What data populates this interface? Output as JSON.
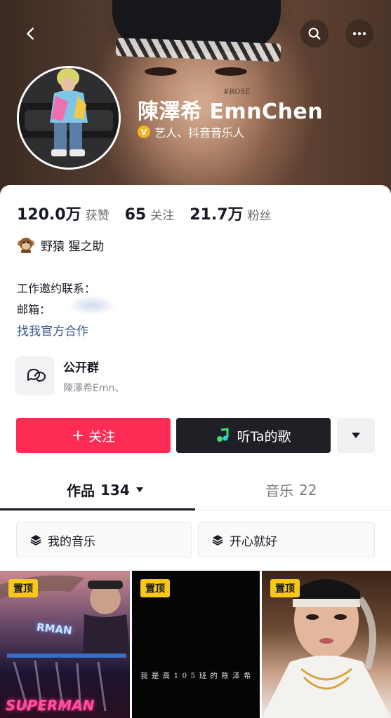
{
  "profile": {
    "name": "陳澤希 EmnChen",
    "header_watermark": "#ROSE",
    "verified_text": "艺人、抖音音乐人"
  },
  "stats": [
    {
      "value": "120.0万",
      "label": "获赞"
    },
    {
      "value": "65",
      "label": "关注"
    },
    {
      "value": "21.7万",
      "label": "粉丝"
    }
  ],
  "bio": {
    "line": "野猿 猩之助",
    "work_contact": "工作邀约联系：",
    "email": "邮箱：",
    "official_link": "找我官方合作"
  },
  "group": {
    "title": "公开群",
    "subtitle": "陳澤希Emn、"
  },
  "actions": {
    "follow": "关注",
    "follow_plus": "+",
    "listen": "听Ta的歌"
  },
  "tabs": {
    "works_label": "作品",
    "works_count": "134",
    "music_label": "音乐",
    "music_count": "22"
  },
  "collections": [
    {
      "label": "我的音乐"
    },
    {
      "label": "开心就好"
    }
  ],
  "videos": [
    {
      "pin": "置顶",
      "overlay": "SUPERMAN",
      "sign": "RMAN"
    },
    {
      "pin": "置顶",
      "caption": "我 是 高 1 0 5 班 的 陈 泽 希"
    },
    {
      "pin": "置顶"
    }
  ],
  "colors": {
    "follow": "#fe2c55",
    "listen": "#1f1f26",
    "pin": "#f7c81b",
    "verified": "#f3b51e",
    "link": "#3b5988"
  }
}
